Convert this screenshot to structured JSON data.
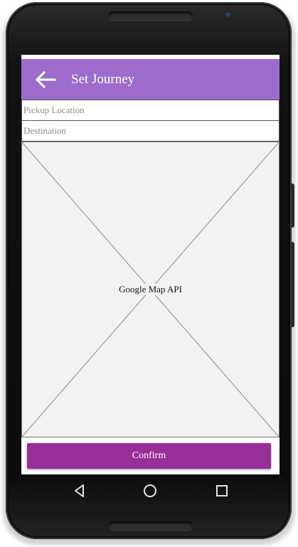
{
  "app_bar": {
    "title": "Set Journey",
    "color": "#9b6ccb",
    "back_icon": "arrow-left-icon"
  },
  "form": {
    "pickup_placeholder": "Pickup Location",
    "pickup_value": "",
    "destination_placeholder": "Destination",
    "destination_value": ""
  },
  "map": {
    "placeholder_label": "Google Map API"
  },
  "confirm_button": {
    "label": "Confirm",
    "color": "#982f98"
  },
  "nav_bar": {
    "back_icon": "triangle-back-icon",
    "home_icon": "circle-home-icon",
    "recent_icon": "square-recents-icon"
  }
}
